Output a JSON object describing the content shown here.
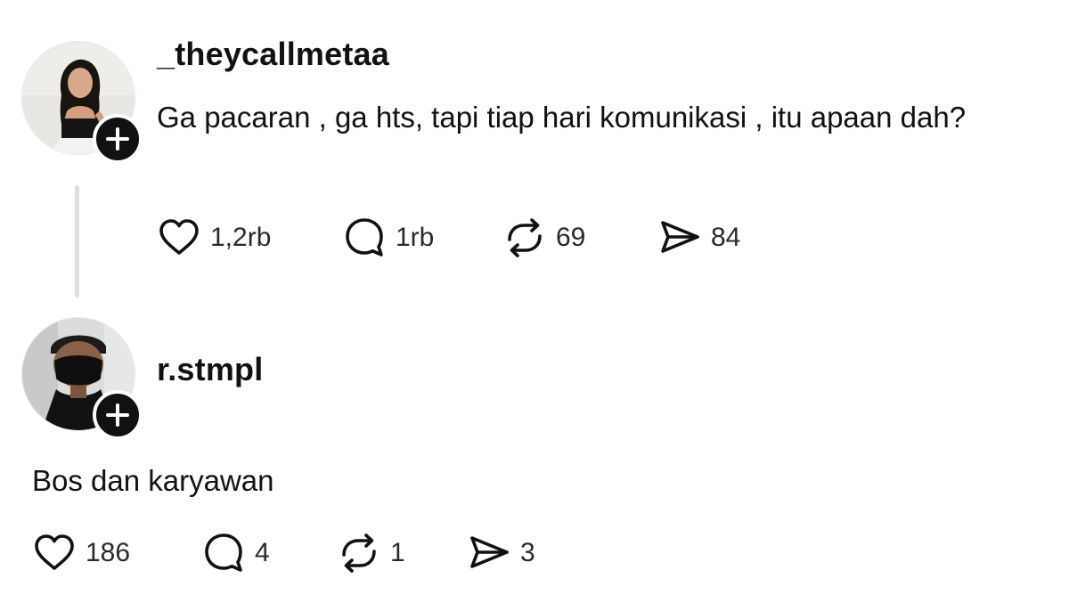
{
  "posts": [
    {
      "username": "_theycallmetaa",
      "text": "Ga pacaran , ga hts, tapi tiap hari komunikasi , itu apaan dah?",
      "likes": "1,2rb",
      "replies": "1rb",
      "reposts": "69",
      "shares": "84"
    },
    {
      "username": "r.stmpl",
      "text": "Bos dan karyawan",
      "likes": "186",
      "replies": "4",
      "reposts": "1",
      "shares": "3"
    }
  ],
  "icons": {
    "like": "heart-icon",
    "reply": "speech-bubble-icon",
    "repost": "repost-arrows-icon",
    "share": "paper-plane-icon",
    "follow": "plus-icon"
  }
}
